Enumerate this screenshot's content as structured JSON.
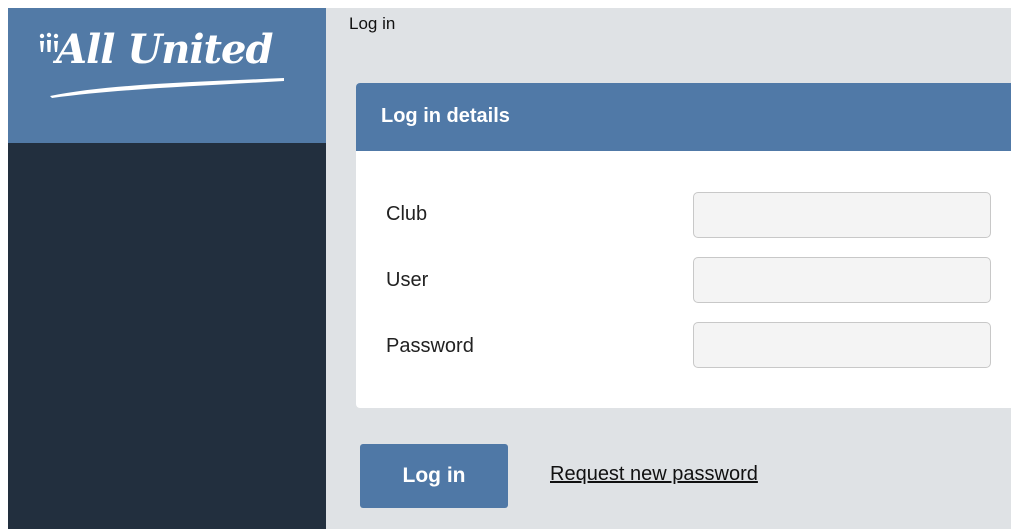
{
  "brand": {
    "logo_text": "All United",
    "logo_mark": "stick-figures-logo-mark",
    "logo_bg_color": "#527aa6",
    "sidebar_color": "#222f3e"
  },
  "page": {
    "title": "Log in"
  },
  "login_panel": {
    "title": "Log in details",
    "header_color": "#5079a7",
    "fields": [
      {
        "label": "Club",
        "value": "",
        "placeholder": ""
      },
      {
        "label": "User",
        "value": "",
        "placeholder": ""
      },
      {
        "label": "Password",
        "value": "",
        "placeholder": ""
      }
    ]
  },
  "actions": {
    "login_label": "Log in",
    "request_password_label": "Request new password",
    "button_color": "#4f78a6"
  }
}
